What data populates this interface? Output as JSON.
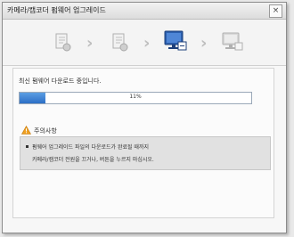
{
  "window": {
    "title": "카메라/캠코더 펌웨어 업그레이드",
    "close_label": "×"
  },
  "steps": [
    {
      "icon": "document-check-icon",
      "state": "done"
    },
    {
      "icon": "document-check-icon",
      "state": "done"
    },
    {
      "icon": "monitor-download-icon",
      "state": "active"
    },
    {
      "icon": "monitor-install-icon",
      "state": "pending"
    }
  ],
  "download": {
    "status": "최신 펌웨어 다운로드 중입니다.",
    "progress_percent": 11,
    "progress_label": "11%"
  },
  "notice": {
    "title": "주의사항",
    "line1": "펌웨어 업그레이드 파일의 다운로드가 완료될 때까지",
    "line2": "카메라/캠코더 전원을 끄거나, 버튼을 누르지 마십시오."
  },
  "colors": {
    "accent": "#2c6fc6",
    "warning": "#f0a020",
    "step_active": "#2b5fae",
    "step_inactive": "#b5b5b5"
  }
}
